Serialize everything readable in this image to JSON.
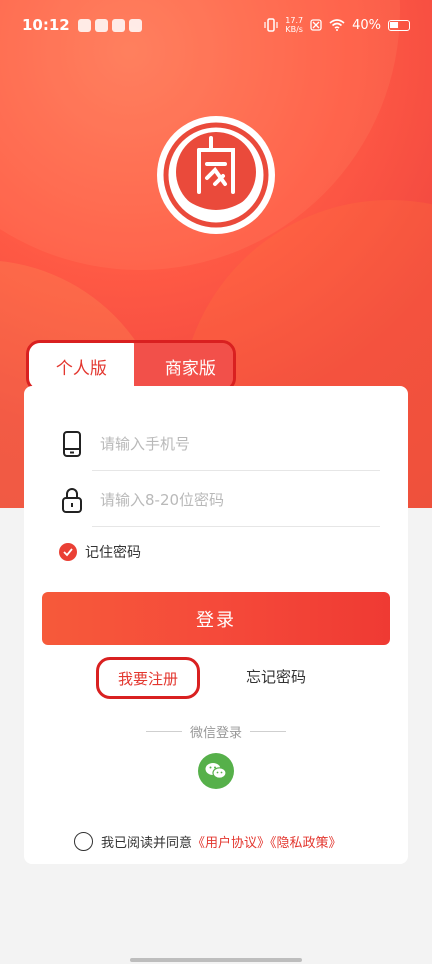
{
  "status_bar": {
    "time": "10:12",
    "net_speed_value": "17.7",
    "net_speed_unit": "KB/s",
    "battery": "40%"
  },
  "tabs": {
    "personal": "个人版",
    "business": "商家版"
  },
  "form": {
    "phone_placeholder": "请输入手机号",
    "password_placeholder": "请输入8-20位密码",
    "remember_label": "记住密码"
  },
  "actions": {
    "login": "登录",
    "register": "我要注册",
    "forgot": "忘记密码"
  },
  "wechat": {
    "label": "微信登录"
  },
  "agreement": {
    "prefix": "我已阅读并同意",
    "user_agreement": "《用户协议》",
    "privacy_policy": "《隐私政策》"
  },
  "colors": {
    "brand_red": "#e3372f",
    "annotation_red": "#d92020",
    "wechat_green": "#56b04a"
  }
}
